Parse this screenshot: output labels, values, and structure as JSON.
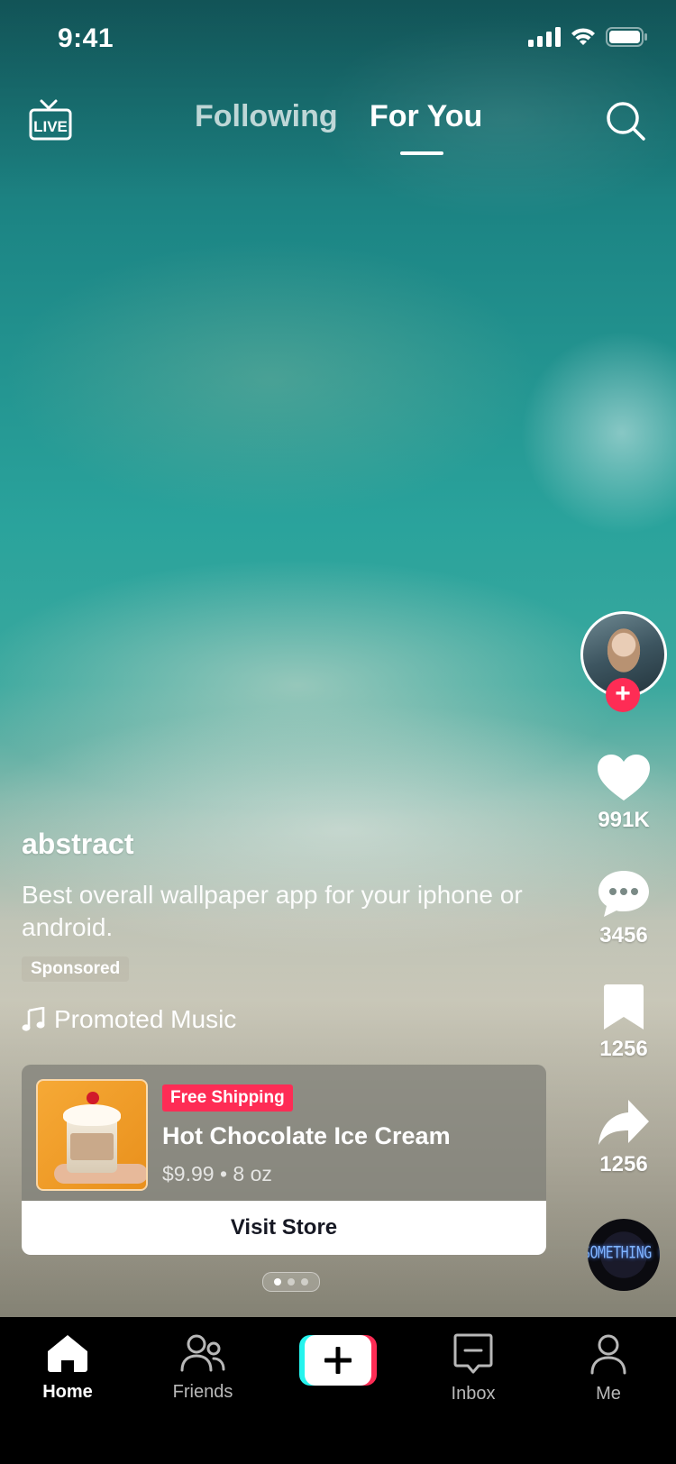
{
  "status_bar": {
    "time": "9:41"
  },
  "top_nav": {
    "live_icon": "live-tv-icon",
    "tabs": [
      {
        "label": "Following",
        "active": false
      },
      {
        "label": "For You",
        "active": true
      }
    ],
    "search_icon": "search-icon"
  },
  "post": {
    "username": "abstract",
    "description": "Best overall wallpaper app for your iphone or android.",
    "sponsored_label": "Sponsored",
    "music_label": "Promoted Music"
  },
  "actions": {
    "likes": "991K",
    "comments": "3456",
    "saves": "1256",
    "shares": "1256",
    "follow_plus": "+",
    "music_disc_text": "SOMETHING GRE"
  },
  "product": {
    "badge": "Free Shipping",
    "name": "Hot Chocolate Ice Cream",
    "meta": "$9.99 • 8 oz",
    "cta": "Visit Store"
  },
  "pagination": {
    "total": 3,
    "current": 1
  },
  "bottom_nav": {
    "items": [
      {
        "label": "Home",
        "icon": "home-icon",
        "active": true
      },
      {
        "label": "Friends",
        "icon": "friends-icon",
        "active": false
      },
      {
        "label": "",
        "icon": "create-plus-icon",
        "active": false
      },
      {
        "label": "Inbox",
        "icon": "inbox-icon",
        "active": false
      },
      {
        "label": "Me",
        "icon": "profile-icon",
        "active": false
      }
    ]
  },
  "colors": {
    "accent_red": "#fe2c55",
    "accent_cyan": "#25f4ee",
    "text_white": "#ffffff",
    "nav_bg": "#000000"
  }
}
